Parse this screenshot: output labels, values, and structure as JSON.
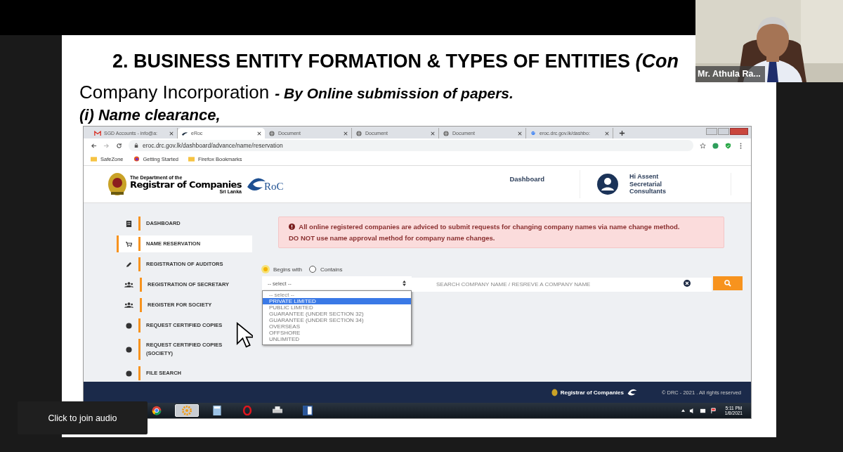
{
  "slide": {
    "title": "2. BUSINESS ENTITY FORMATION & TYPES OF ENTITIES",
    "title_italic": "(Con",
    "subtitle": "Company Incorporation",
    "subtitle_note": "- By Online submission of papers.",
    "step": "(i) Name clearance,"
  },
  "browser": {
    "tabs": [
      {
        "label": "SGD Accounts - info@a:",
        "kind": "gmail",
        "selected": false
      },
      {
        "label": "eRoc",
        "kind": "eroc",
        "selected": true
      },
      {
        "label": "Document",
        "kind": "globe",
        "selected": false
      },
      {
        "label": "Document",
        "kind": "globe",
        "selected": false
      },
      {
        "label": "Document",
        "kind": "globe",
        "selected": false
      },
      {
        "label": "eroc.drc.gov.lk/dashbo:",
        "kind": "google",
        "selected": false
      }
    ],
    "address": "eroc.drc.gov.lk/dashboard/advance/name/reservation",
    "bookmarks": [
      {
        "label": "SafeZone",
        "kind": "folder"
      },
      {
        "label": "Getting Started",
        "kind": "firefox"
      },
      {
        "label": "Firefox Bookmarks",
        "kind": "folder"
      }
    ]
  },
  "site": {
    "logo_top": "The Department of the",
    "logo_main": "Registrar of Companies",
    "logo_sub": "Sri Lanka",
    "eroc_text": "RoC",
    "nav_link": "Dashboard",
    "user": "Hi Assent Secretarial Consultants"
  },
  "sidebar": {
    "items": [
      {
        "label": "DASHBOARD",
        "kind": "building",
        "selected": false
      },
      {
        "label": "NAME RESERVATION",
        "kind": "cart",
        "selected": true
      },
      {
        "label": "REGISTRATION OF AUDITORS",
        "kind": "pen",
        "selected": false
      },
      {
        "label": "REGISTRATION OF SECRETARY",
        "kind": "group",
        "selected": false
      },
      {
        "label": "REGISTER FOR SOCIETY",
        "kind": "group",
        "selected": false
      },
      {
        "label": "REQUEST CERTIFIED COPIES",
        "kind": "blob",
        "selected": false
      },
      {
        "label": "REQUEST CERTIFIED COPIES (SOCIETY)",
        "kind": "blob",
        "selected": false
      },
      {
        "label": "FILE SEARCH",
        "kind": "blob",
        "selected": false
      }
    ]
  },
  "alert": "All online registered companies are adviced to submit requests for changing company names via name change method. DO NOT use name approval method for company name changes.",
  "search": {
    "modes": [
      {
        "label": "Begins with",
        "selected": true
      },
      {
        "label": "Contains",
        "selected": false
      }
    ],
    "select_value": "-- select --",
    "options": [
      {
        "label": "-- select --",
        "selected": false
      },
      {
        "label": "PRIVATE LIMITED",
        "selected": true
      },
      {
        "label": "PUBLIC LIMITED",
        "selected": false
      },
      {
        "label": "GUARANTEE (UNDER SECTION 32)",
        "selected": false
      },
      {
        "label": "GUARANTEE (UNDER SECTION 34)",
        "selected": false
      },
      {
        "label": "OVERSEAS",
        "selected": false
      },
      {
        "label": "OFFSHORE",
        "selected": false
      },
      {
        "label": "UNLIMITED",
        "selected": false
      }
    ],
    "placeholder": "SEARCH COMPANY NAME / RESREVE A COMPANY NAME"
  },
  "footer": {
    "logo_main": "Registrar of Companies",
    "copyright": "© DRC - 2021 . All rights reserved"
  },
  "taskbar": {
    "apps": [
      {
        "kind": "chrome",
        "selected": false
      },
      {
        "kind": "gear",
        "selected": true
      },
      {
        "kind": "calculator",
        "selected": false
      },
      {
        "kind": "opera",
        "selected": false
      },
      {
        "kind": "printer",
        "selected": false
      },
      {
        "kind": "word",
        "selected": false
      }
    ],
    "time": "5:11 PM",
    "date": "1/8/2021"
  },
  "video": {
    "name": "Mr. Athula Ra..."
  },
  "tooltip": "Click to join audio"
}
